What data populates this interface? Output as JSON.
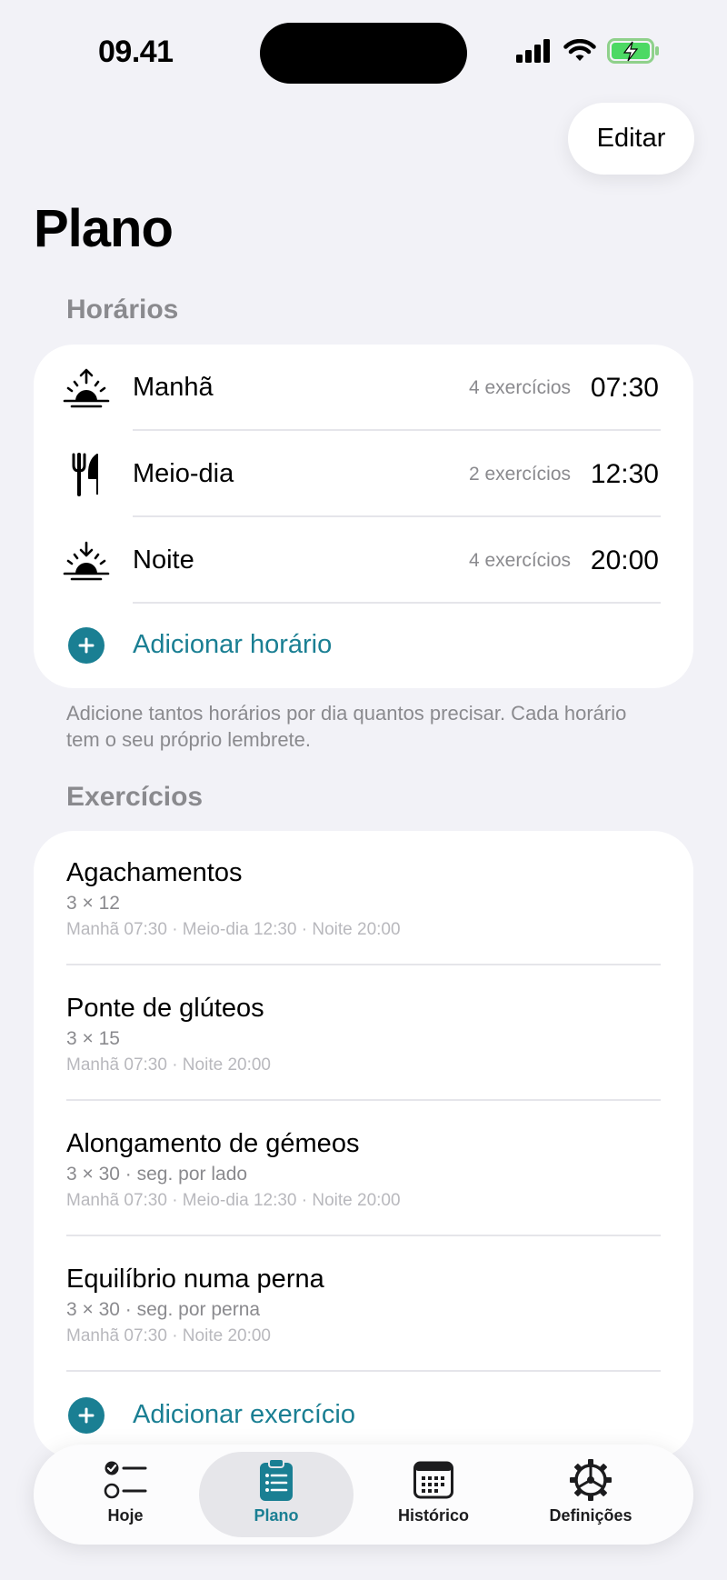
{
  "status_bar": {
    "time": "09.41"
  },
  "header": {
    "edit_label": "Editar",
    "title": "Plano"
  },
  "schedules": {
    "header": "Horários",
    "items": [
      {
        "icon": "sunrise-icon",
        "label": "Manhã",
        "count": "4 exercícios",
        "time": "07:30"
      },
      {
        "icon": "fork-knife-icon",
        "label": "Meio-dia",
        "count": "2 exercícios",
        "time": "12:30"
      },
      {
        "icon": "sunset-icon",
        "label": "Noite",
        "count": "4 exercícios",
        "time": "20:00"
      }
    ],
    "add_label": "Adicionar horário",
    "footnote": "Adicione tantos horários por dia quantos precisar. Cada horário tem o seu próprio lembrete."
  },
  "exercises": {
    "header": "Exercícios",
    "items": [
      {
        "name": "Agachamentos",
        "sets": "3 × 12",
        "schedule": "Manhã 07:30 · Meio-dia 12:30 · Noite 20:00"
      },
      {
        "name": "Ponte de glúteos",
        "sets": "3 × 15",
        "schedule": "Manhã 07:30 · Noite 20:00"
      },
      {
        "name": "Alongamento de gémeos",
        "sets": "3 × 30 · seg. por lado",
        "schedule": "Manhã 07:30 · Meio-dia 12:30 · Noite 20:00"
      },
      {
        "name": "Equilíbrio numa perna",
        "sets": "3 × 30 · seg. por perna",
        "schedule": "Manhã 07:30 · Noite 20:00"
      }
    ],
    "add_label": "Adicionar exercício"
  },
  "tabbar": {
    "tabs": [
      {
        "label": "Hoje",
        "icon": "checklist-icon"
      },
      {
        "label": "Plano",
        "icon": "clipboard-icon",
        "active": true
      },
      {
        "label": "Histórico",
        "icon": "calendar-icon"
      },
      {
        "label": "Definições",
        "icon": "gear-icon"
      }
    ]
  },
  "colors": {
    "accent": "#1a7f93",
    "background": "#f2f2f7",
    "secondary_text": "#8a8a8e"
  }
}
